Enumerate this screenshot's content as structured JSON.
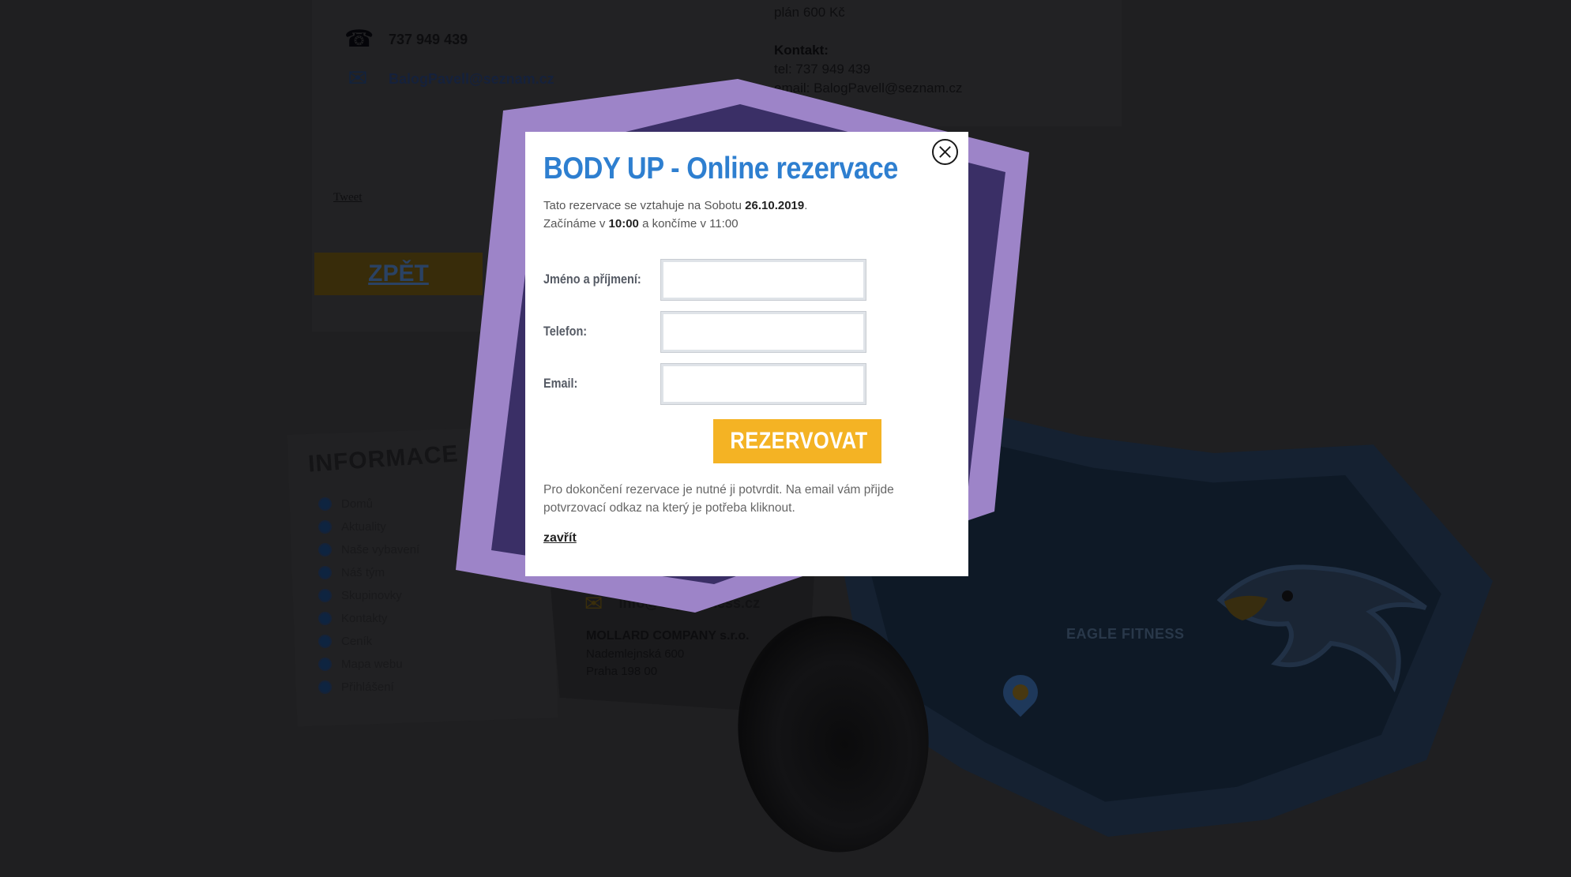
{
  "background": {
    "phone": "737 949 439",
    "email": "BalogPavell@seznam.cz",
    "tweet_label": "Tweet",
    "back_button": "ZPĚT",
    "price_text": "plán 600 Kč",
    "contact_heading": "Kontakt:",
    "contact_phone": "tel: 737 949 439",
    "contact_email": "email: BalogPavell@seznam.cz",
    "info_heading": "INFORMACE",
    "info_items": [
      "Domů",
      "Aktuality",
      "Naše vybavení",
      "Náš tým",
      "Skupinovky",
      "Kontakty",
      "Ceník",
      "Mapa webu",
      "Přihlášení"
    ],
    "company_email": "info@eaglefitness.cz",
    "company_name": "MOLLARD COMPANY s.r.o.",
    "company_street": "Nademlejnská 600",
    "company_city": "Praha 198 00",
    "map_label": "EAGLE FITNESS"
  },
  "modal": {
    "title": "BODY UP - Online rezervace",
    "intro_prefix": "Tato rezervace se vztahuje na Sobotu ",
    "date": "26.10.2019",
    "intro_suffix": ".",
    "time_prefix": "Začínáme v ",
    "start_time": "10:00",
    "time_middle": " a končíme v ",
    "end_time": "11:00",
    "fields": {
      "name_label": "Jméno a příjmení:",
      "name_value": "",
      "phone_label": "Telefon:",
      "phone_value": "",
      "email_label": "Email:",
      "email_value": ""
    },
    "submit_label": "REZERVOVAT",
    "note": "Pro dokončení rezervace je nutné ji potvrdit. Na email vám přijde potvrzovací odkaz na který je potřeba kliknout.",
    "close_link": "zavřít"
  },
  "colors": {
    "title_blue": "#2e7fd0",
    "button_yellow": "#f4b324",
    "deco_purple": "#9d84c8",
    "deco_dark": "#3a2f66"
  },
  "icons": {
    "phone": "telephone-icon",
    "mail": "envelope-icon",
    "close": "close-icon",
    "pin": "map-pin-icon"
  }
}
